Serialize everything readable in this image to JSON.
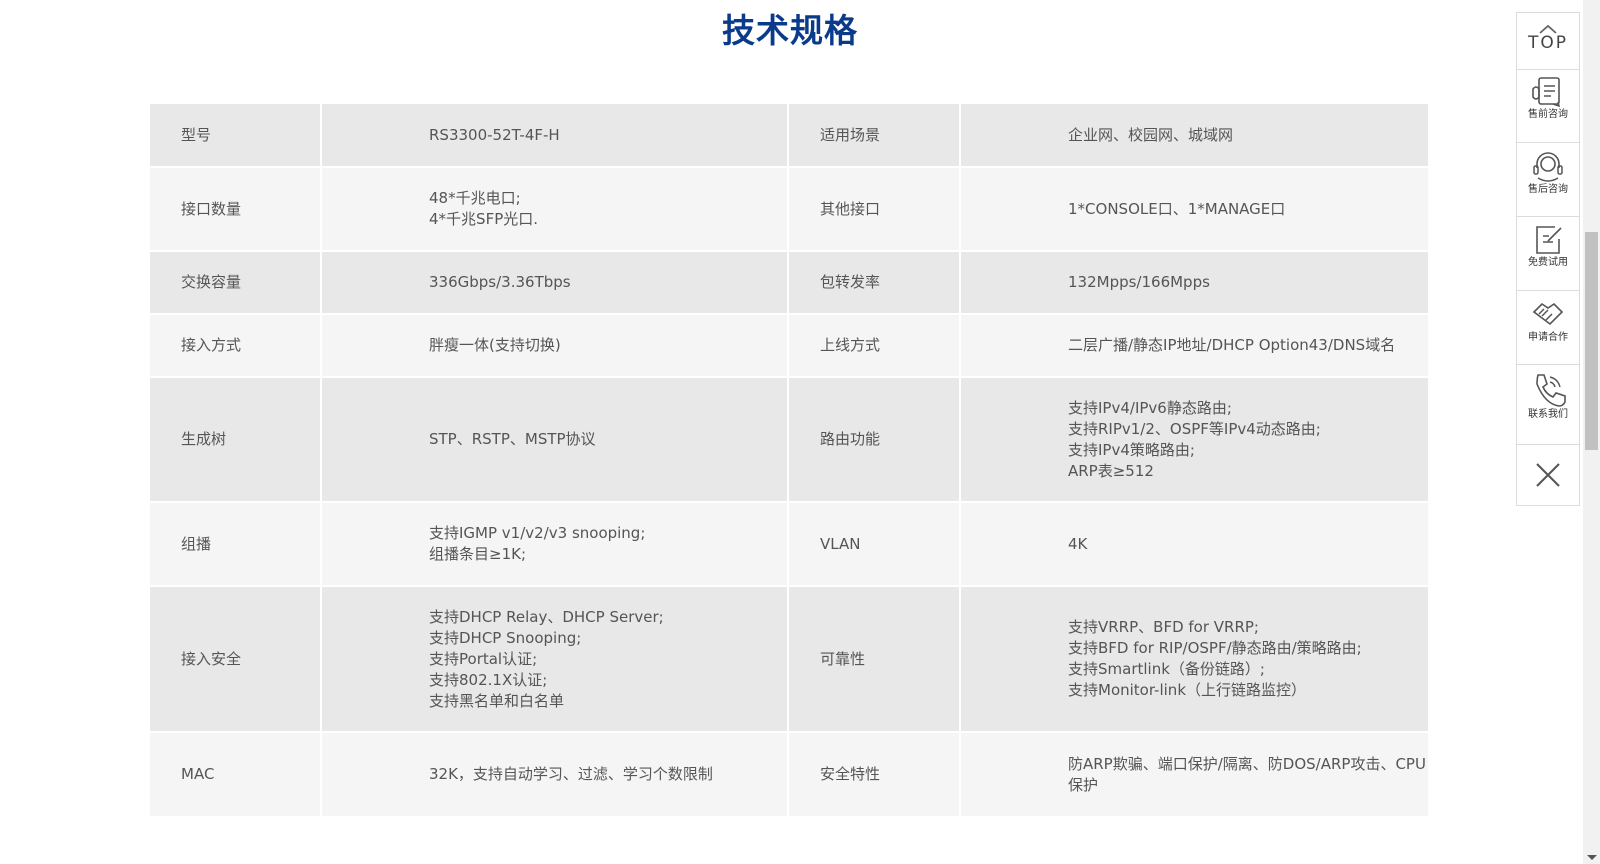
{
  "title": "技术规格",
  "specs": [
    {
      "k1": "型号",
      "v1": [
        "RS3300-52T-4F-H"
      ],
      "k2": "适用场景",
      "v2": [
        "企业网、校园网、城域网"
      ]
    },
    {
      "k1": "接口数量",
      "v1": [
        "48*千兆电口;",
        "4*千兆SFP光口."
      ],
      "k2": "其他接口",
      "v2": [
        "1*CONSOLE口、1*MANAGE口"
      ]
    },
    {
      "k1": "交换容量",
      "v1": [
        "336Gbps/3.36Tbps"
      ],
      "k2": "包转发率",
      "v2": [
        "132Mpps/166Mpps"
      ]
    },
    {
      "k1": "接入方式",
      "v1": [
        "胖瘦一体(支持切换)"
      ],
      "k2": "上线方式",
      "v2": [
        "二层广播/静态IP地址/DHCP Option43/DNS域名"
      ]
    },
    {
      "k1": "生成树",
      "v1": [
        "STP、RSTP、MSTP协议"
      ],
      "k2": "路由功能",
      "v2": [
        "支持IPv4/IPv6静态路由;",
        "支持RIPv1/2、OSPF等IPv4动态路由;",
        "支持IPv4策略路由;",
        "ARP表≥512"
      ]
    },
    {
      "k1": "组播",
      "v1": [
        "支持IGMP v1/v2/v3 snooping;",
        "组播条目≥1K;"
      ],
      "k2": "VLAN",
      "v2": [
        "4K"
      ]
    },
    {
      "k1": "接入安全",
      "v1": [
        "支持DHCP Relay、DHCP Server;",
        "支持DHCP Snooping;",
        "支持Portal认证;",
        "支持802.1X认证;",
        "支持黑名单和白名单"
      ],
      "k2": "可靠性",
      "v2": [
        "支持VRRP、BFD for VRRP;",
        "支持BFD for RIP/OSPF/静态路由/策略路由;",
        "支持Smartlink（备份链路）;",
        "支持Monitor-link（上行链路监控）"
      ]
    },
    {
      "k1": "MAC",
      "v1": [
        "32K，支持自动学习、过滤、学习个数限制"
      ],
      "k2": "安全特性",
      "v2": [
        "防ARP欺骗、端口保护/隔离、防DOS/ARP攻击、CPU保护"
      ]
    }
  ],
  "sidebar": {
    "top_label": "TOP",
    "items": [
      {
        "label": "售前咨询",
        "icon": "presales-icon"
      },
      {
        "label": "售后咨询",
        "icon": "headset-icon"
      },
      {
        "label": "免费试用",
        "icon": "edit-note-icon"
      },
      {
        "label": "申请合作",
        "icon": "handshake-icon"
      },
      {
        "label": "联系我们",
        "icon": "phone-icon"
      }
    ],
    "close_icon": "close-icon"
  }
}
